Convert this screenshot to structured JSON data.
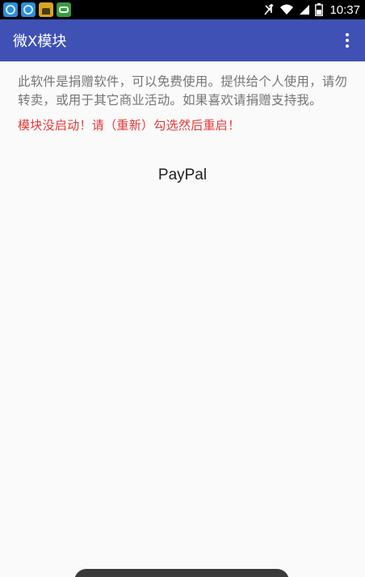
{
  "status_bar": {
    "time": "10:37",
    "notifications": [
      "sync-icon",
      "sync-icon",
      "android-icon",
      "gamepad-icon"
    ],
    "system_icons": [
      "mute-icon",
      "wifi-icon",
      "signal-icon",
      "battery-icon"
    ]
  },
  "app_bar": {
    "title": "微X模块",
    "overflow_icon": "more-vert-icon",
    "color": "#3f51b5"
  },
  "content": {
    "description": "此软件是捐赠软件，可以免费使用。提供给个人使用，请勿转卖，或用于其它商业活动。如果喜欢请捐赠支持我。",
    "warning": "模块没启动！请（重新）勾选然后重启！",
    "warning_color": "#e53935",
    "paypal_label": "PayPal"
  }
}
